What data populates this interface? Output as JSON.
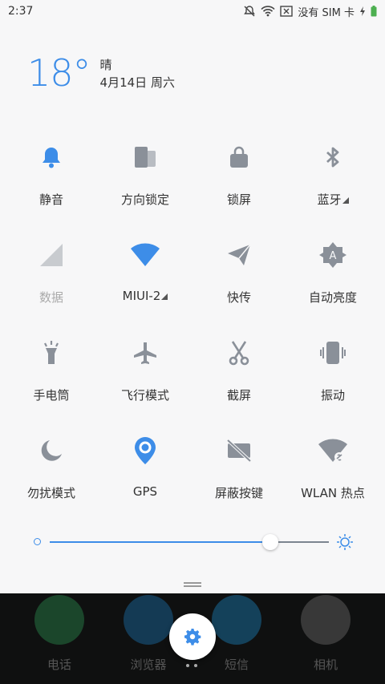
{
  "status_bar": {
    "time": "2:37",
    "carrier": "没有 SIM 卡"
  },
  "weather": {
    "temperature": "18°",
    "condition": "晴",
    "date": "4月14日 周六"
  },
  "tiles": [
    {
      "id": "silent",
      "label": "静音",
      "icon": "bell-icon",
      "active": true
    },
    {
      "id": "rotation",
      "label": "方向锁定",
      "icon": "rotation-lock-icon",
      "active": false
    },
    {
      "id": "lock",
      "label": "锁屏",
      "icon": "lock-icon",
      "active": false
    },
    {
      "id": "bluetooth",
      "label": "蓝牙",
      "icon": "bluetooth-icon",
      "active": false,
      "expandable": true
    },
    {
      "id": "data",
      "label": "数据",
      "icon": "mobile-data-icon",
      "active": false,
      "disabled": true
    },
    {
      "id": "wifi",
      "label": "MIUI-2",
      "icon": "wifi-icon",
      "active": true,
      "expandable": true
    },
    {
      "id": "share",
      "label": "快传",
      "icon": "paper-plane-icon",
      "active": false
    },
    {
      "id": "auto-brightness",
      "label": "自动亮度",
      "icon": "auto-brightness-icon",
      "active": false
    },
    {
      "id": "flashlight",
      "label": "手电筒",
      "icon": "flashlight-icon",
      "active": false
    },
    {
      "id": "airplane",
      "label": "飞行模式",
      "icon": "airplane-icon",
      "active": false
    },
    {
      "id": "screenshot",
      "label": "截屏",
      "icon": "scissors-icon",
      "active": false
    },
    {
      "id": "vibrate",
      "label": "振动",
      "icon": "vibrate-icon",
      "active": false
    },
    {
      "id": "dnd",
      "label": "勿扰模式",
      "icon": "moon-icon",
      "active": false
    },
    {
      "id": "gps",
      "label": "GPS",
      "icon": "location-pin-icon",
      "active": true
    },
    {
      "id": "hide-keys",
      "label": "屏蔽按键",
      "icon": "hide-keys-icon",
      "active": false
    },
    {
      "id": "hotspot",
      "label": "WLAN 热点",
      "icon": "hotspot-icon",
      "active": false
    }
  ],
  "brightness": {
    "level": 0.79
  },
  "dock": [
    {
      "label": "电话",
      "icon": "phone-icon",
      "color": "#2b8a4e"
    },
    {
      "label": "浏览器",
      "icon": "browser-icon",
      "color": "#1a6fa8"
    },
    {
      "label": "短信",
      "icon": "sms-icon",
      "color": "#1a7fb6"
    },
    {
      "label": "相机",
      "icon": "camera-icon",
      "color": "#6b6b6b"
    }
  ],
  "colors": {
    "accent": "#3d8de8",
    "icon_inactive": "#8a9099",
    "background": "#f7f7f8"
  }
}
